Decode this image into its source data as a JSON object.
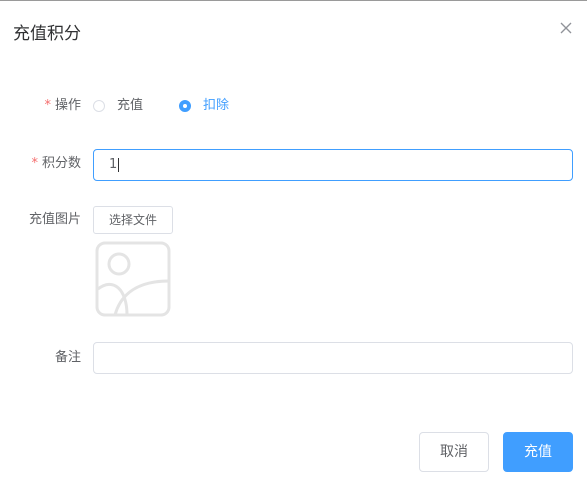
{
  "dialog": {
    "title": "充值积分",
    "close_icon": "close-icon"
  },
  "form": {
    "operation": {
      "required": "*",
      "label": "操作",
      "options": [
        {
          "label": "充值",
          "checked": false
        },
        {
          "label": "扣除",
          "checked": true
        }
      ]
    },
    "points": {
      "required": "*",
      "label": "积分数",
      "value": "1"
    },
    "image": {
      "label": "充值图片",
      "button_label": "选择文件",
      "preview_icon": "image-placeholder-icon"
    },
    "remark": {
      "label": "备注",
      "value": ""
    }
  },
  "footer": {
    "cancel_label": "取消",
    "submit_label": "充值"
  },
  "colors": {
    "primary": "#409eff",
    "required": "#f56c6c",
    "border": "#dcdfe6",
    "text": "#606266"
  }
}
